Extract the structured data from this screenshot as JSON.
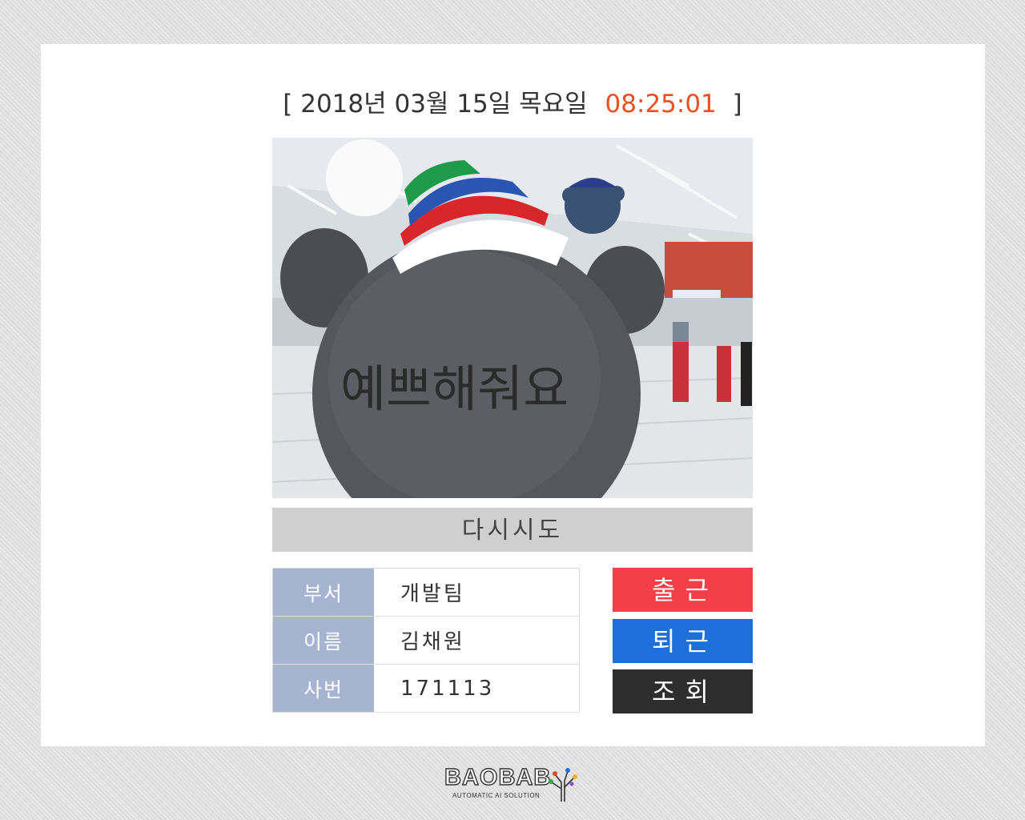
{
  "header": {
    "date_text": "2018년 03월 15일 목요일",
    "time_text": "08:25:01",
    "bracket_open": "[",
    "bracket_close": "]"
  },
  "photo": {
    "handwriting_text": "예쁘해줘요"
  },
  "retry_button": {
    "label": "다시시도"
  },
  "employee": {
    "rows": [
      {
        "label": "부서",
        "value": "개발팀"
      },
      {
        "label": "이름",
        "value": "김채원"
      },
      {
        "label": "사번",
        "value": "171113"
      }
    ]
  },
  "actions": {
    "check_in": "출근",
    "check_out": "퇴근",
    "lookup": "조회"
  },
  "brand": {
    "name": "BAOBAB",
    "tagline": "AUTOMATIC AI SOLUTION"
  },
  "colors": {
    "time": "#e8501f",
    "check_in": "#f43f48",
    "check_out": "#1f6fdb",
    "lookup": "#2e2e2e",
    "label_bg": "#a6b3d1",
    "retry_bg": "#cfcfcf"
  }
}
